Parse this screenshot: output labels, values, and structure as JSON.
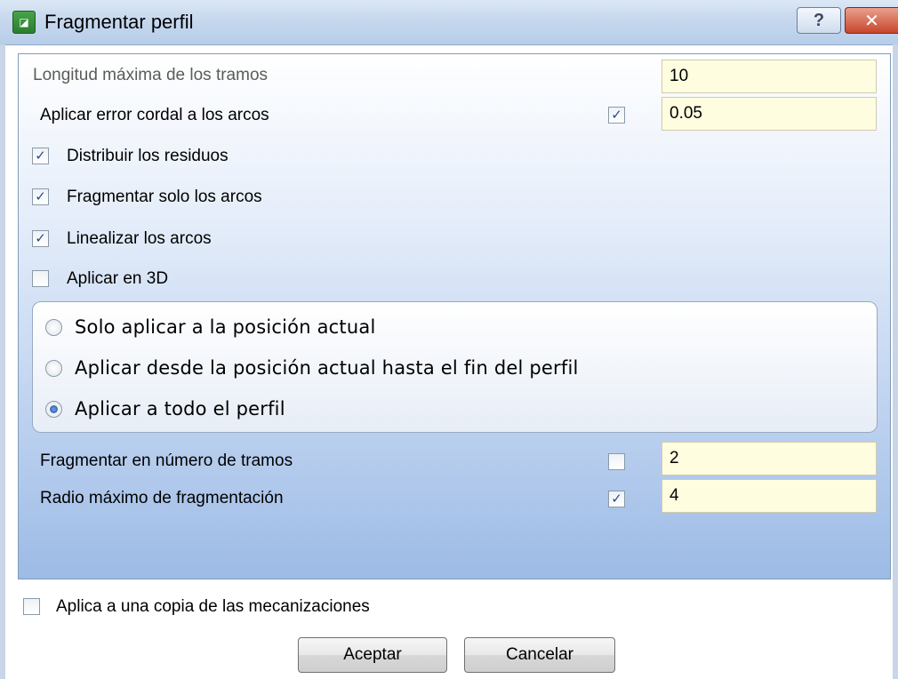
{
  "window": {
    "title": "Fragmentar perfil",
    "icon": "app-logo-icon",
    "help_label": "?",
    "close_label": "✕"
  },
  "fields": {
    "max_length": {
      "label": "Longitud máxima de los tramos",
      "value": "10"
    },
    "chordal_error": {
      "label": "Aplicar error cordal a los arcos",
      "checked": true,
      "value": "0.05"
    },
    "segment_count": {
      "label": "Fragmentar en número de tramos",
      "checked": false,
      "value": "2"
    },
    "max_radius": {
      "label": "Radio máximo de fragmentación",
      "checked": true,
      "value": "4"
    }
  },
  "options": {
    "distribute": {
      "label": "Distribuir los residuos",
      "checked": true
    },
    "only_arcs": {
      "label": "Fragmentar solo los arcos",
      "checked": true
    },
    "linearize": {
      "label": "Linealizar los arcos",
      "checked": true
    },
    "apply_3d": {
      "label": "Aplicar en 3D",
      "checked": false
    }
  },
  "scope": {
    "options": [
      {
        "label": "Solo aplicar a la posición actual",
        "selected": false
      },
      {
        "label": "Aplicar desde la posición actual hasta el fin del perfil",
        "selected": false
      },
      {
        "label": "Aplicar a todo el perfil",
        "selected": true
      }
    ]
  },
  "copy": {
    "label": "Aplica a una copia de las mecanizaciones",
    "checked": false
  },
  "buttons": {
    "ok": "Aceptar",
    "cancel": "Cancelar"
  },
  "colors": {
    "field_bg": "#fffde0",
    "panel_bottom": "#9dbbe6",
    "close_red": "#c8452c"
  }
}
